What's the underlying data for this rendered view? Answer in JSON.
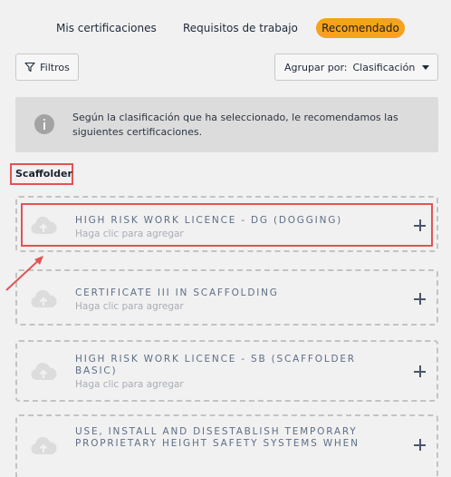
{
  "tabs": [
    {
      "label": "Mis certificaciones",
      "active": false
    },
    {
      "label": "Requisitos de trabajo",
      "active": false
    },
    {
      "label": "Recomendado",
      "active": true
    }
  ],
  "toolbar": {
    "filter_label": "Filtros",
    "group_prefix": "Agrupar por:",
    "group_value": "Clasificación"
  },
  "info": {
    "text": "Según la clasificación que ha seleccionado, le recomendamos las siguientes certificaciones."
  },
  "section": {
    "title": "Scaffolder"
  },
  "certifications": [
    {
      "title": "HIGH RISK WORK LICENCE - DG (DOGGING)",
      "subtitle": "Haga clic para agregar"
    },
    {
      "title": "CERTIFICATE III IN SCAFFOLDING",
      "subtitle": "Haga clic para agregar"
    },
    {
      "title": "HIGH RISK WORK LICENCE - SB (SCAFFOLDER BASIC)",
      "subtitle": "Haga clic para agregar"
    },
    {
      "title": "USE, INSTALL AND DISESTABLISH TEMPORARY PROPRIETARY HEIGHT SAFETY SYSTEMS WHEN",
      "subtitle": ""
    }
  ],
  "colors": {
    "accent": "#f7a21b",
    "annotation": "#e35353",
    "card_title": "#5e6e86"
  },
  "icons": [
    "filter-icon",
    "caret-down-icon",
    "info-icon",
    "cloud-upload-icon",
    "plus-icon",
    "arrow-annotation"
  ]
}
